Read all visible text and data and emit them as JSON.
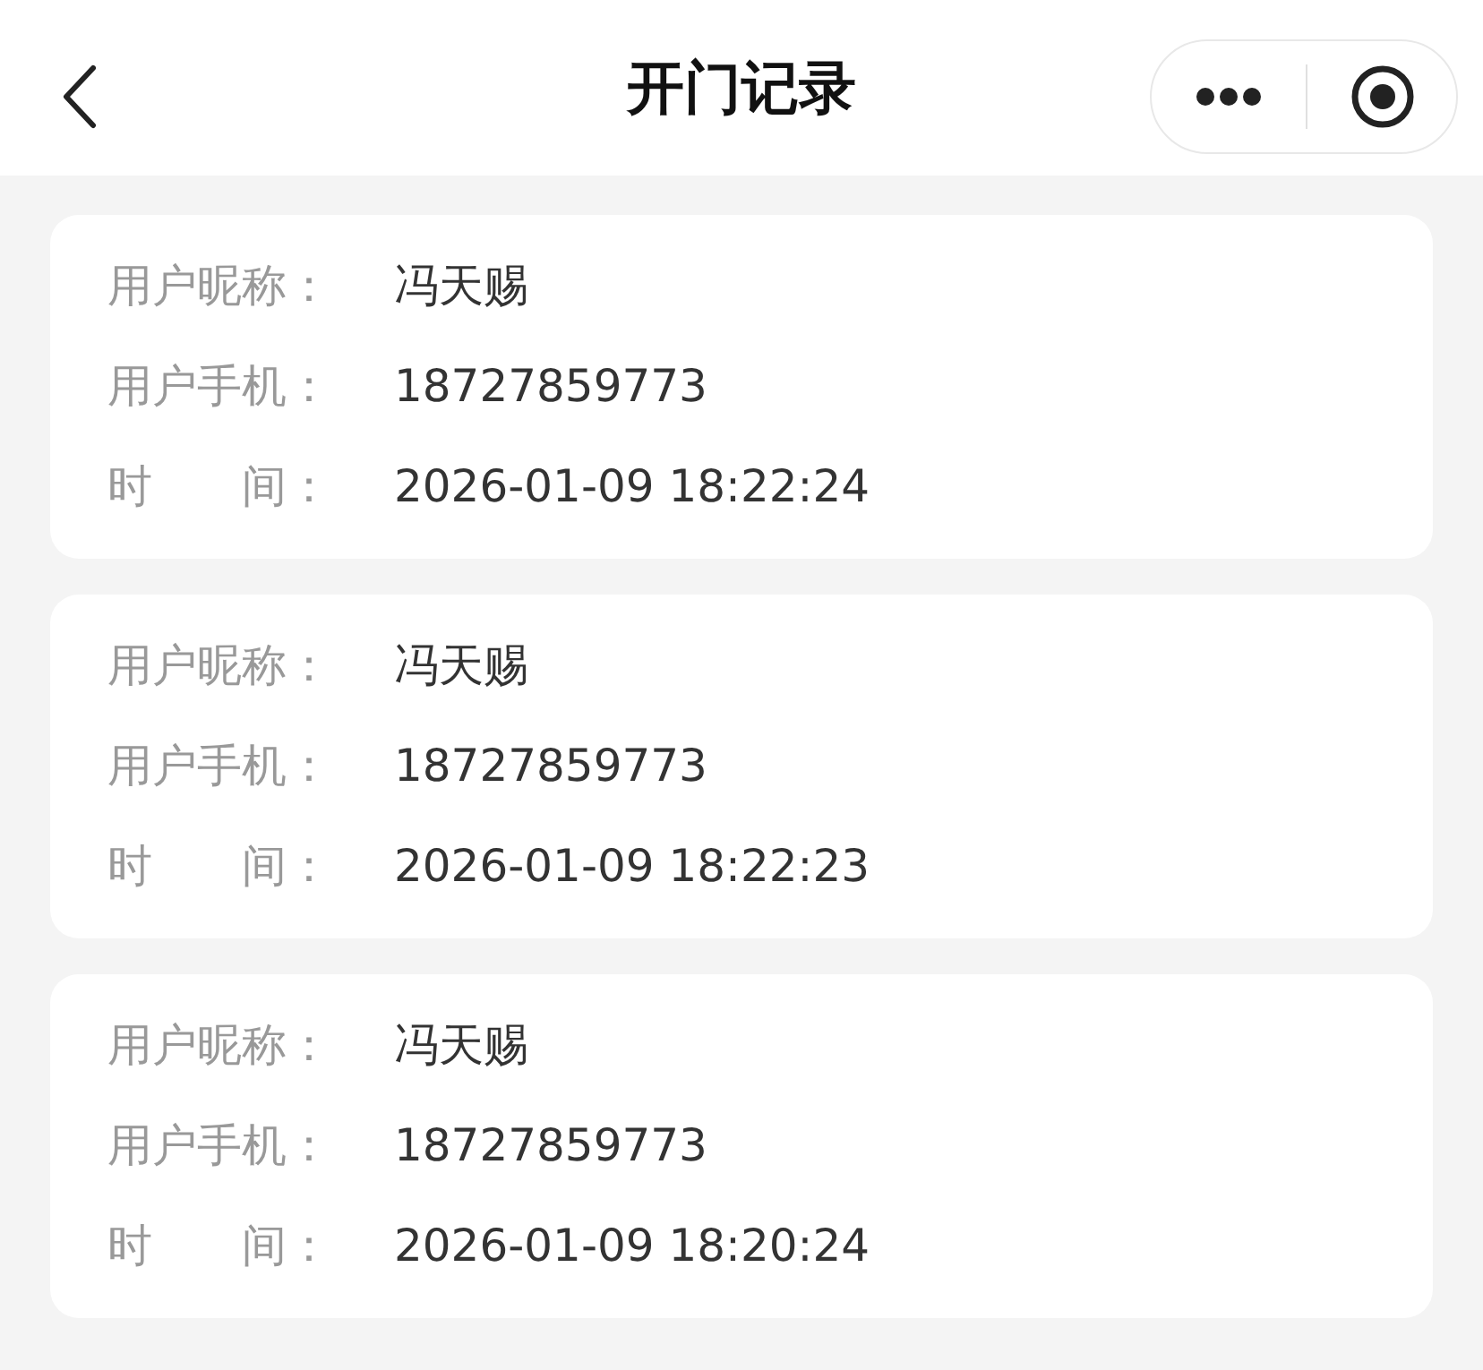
{
  "header": {
    "title": "开门记录"
  },
  "records": [
    {
      "fields": [
        {
          "label": "用户昵称：",
          "value": "冯天赐"
        },
        {
          "label": "用户手机：",
          "value": "18727859773"
        },
        {
          "label": "时　　间：",
          "value": "2026-01-09 18:22:24"
        }
      ]
    },
    {
      "fields": [
        {
          "label": "用户昵称：",
          "value": "冯天赐"
        },
        {
          "label": "用户手机：",
          "value": "18727859773"
        },
        {
          "label": "时　　间：",
          "value": "2026-01-09 18:22:23"
        }
      ]
    },
    {
      "fields": [
        {
          "label": "用户昵称：",
          "value": "冯天赐"
        },
        {
          "label": "用户手机：",
          "value": "18727859773"
        },
        {
          "label": "时　　间：",
          "value": "2026-01-09 18:20:24"
        }
      ]
    }
  ]
}
